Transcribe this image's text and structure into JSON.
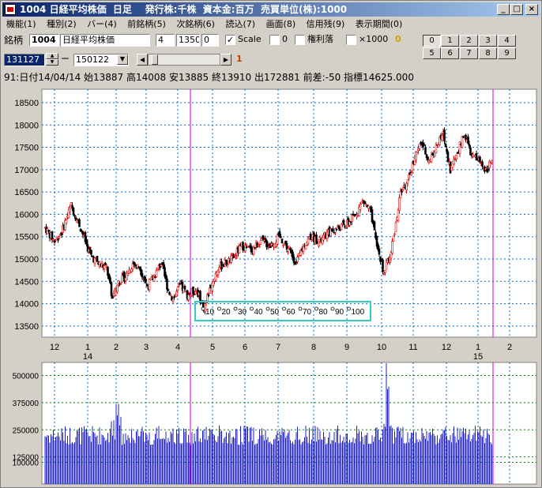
{
  "window": {
    "title": "1004 日経平均株価  日足    発行株:千株  資本金:百万  売買単位(株):1000",
    "min": "_",
    "max": "□",
    "close": "×"
  },
  "menu": [
    "機能(1)",
    "種別(2)",
    "バー(4)",
    "前銘柄(5)",
    "次銘柄(6)",
    "読込(7)",
    "画面(8)",
    "信用残(9)",
    "表示期間(0)"
  ],
  "toolbar": {
    "label_code": "銘柄",
    "code": "1004",
    "name": "日経平均株価",
    "f1": "4",
    "f2": "1350",
    "f3": "0",
    "scale_label": "Scale",
    "zero_label": "0",
    "kenri_label": "権利落",
    "x1000_label": "×1000",
    "badge0": "0",
    "date_from": "131127",
    "dash": "ー",
    "date_to": "150122",
    "badge1": "1",
    "left_arrow": "◀",
    "right_arrow": "▶",
    "num_buttons": [
      "0",
      "1",
      "2",
      "3",
      "4",
      "5",
      "6",
      "7",
      "8",
      "9"
    ],
    "selected_num": "0"
  },
  "info": "91:日付14/04/14 始13887 高14008 安13885 終13910 出172881 前差:-50 指標14625.000",
  "price_chart": {
    "ylim": [
      13250,
      18800
    ],
    "y_ticks": [
      13500,
      14000,
      14500,
      15000,
      15500,
      16000,
      16500,
      17000,
      17500,
      18000,
      18500
    ],
    "x_month_labels": [
      "12",
      "1",
      "2",
      "3",
      "4",
      "5",
      "6",
      "7",
      "8",
      "9",
      "10",
      "11",
      "12",
      "1",
      "2"
    ],
    "year_labels": [
      "14",
      "15"
    ],
    "overlay_labels": [
      "10",
      "20",
      "30",
      "40",
      "50",
      "60",
      "70",
      "80",
      "90",
      "100"
    ],
    "colors": {
      "up": "#e00000",
      "down": "#000000",
      "grid": "#0066cc",
      "cursor": "#cc00cc",
      "overlay": "#33cccc"
    }
  },
  "volume_chart": {
    "ylim": [
      0,
      560000
    ],
    "y_ticks": [
      100000,
      125000,
      250000,
      375000,
      500000
    ],
    "tick_labels": [
      "100000",
      "125000",
      "250000",
      "375000",
      "500000"
    ],
    "bar_color": "#2020c0"
  },
  "chart_data": [
    {
      "type": "candlestick",
      "series_close_anchors": [
        [
          0,
          15700
        ],
        [
          8,
          15400
        ],
        [
          14,
          15600
        ],
        [
          22,
          16200
        ],
        [
          30,
          15700
        ],
        [
          38,
          15100
        ],
        [
          45,
          14900
        ],
        [
          52,
          14800
        ],
        [
          57,
          14100
        ],
        [
          62,
          14500
        ],
        [
          68,
          14600
        ],
        [
          74,
          14900
        ],
        [
          80,
          14800
        ],
        [
          86,
          14400
        ],
        [
          92,
          14600
        ],
        [
          98,
          14900
        ],
        [
          104,
          14300
        ],
        [
          108,
          14100
        ],
        [
          114,
          14400
        ],
        [
          120,
          14200
        ],
        [
          128,
          14300
        ],
        [
          134,
          13900
        ],
        [
          140,
          14400
        ],
        [
          146,
          14800
        ],
        [
          152,
          14900
        ],
        [
          158,
          15000
        ],
        [
          166,
          15300
        ],
        [
          174,
          15200
        ],
        [
          182,
          15400
        ],
        [
          190,
          15300
        ],
        [
          198,
          15500
        ],
        [
          206,
          15200
        ],
        [
          212,
          14900
        ],
        [
          218,
          15300
        ],
        [
          224,
          15500
        ],
        [
          232,
          15400
        ],
        [
          240,
          15600
        ],
        [
          248,
          15700
        ],
        [
          256,
          15800
        ],
        [
          262,
          16000
        ],
        [
          268,
          16300
        ],
        [
          274,
          16100
        ],
        [
          280,
          15300
        ],
        [
          286,
          14700
        ],
        [
          292,
          15200
        ],
        [
          296,
          15800
        ],
        [
          300,
          16500
        ],
        [
          306,
          16700
        ],
        [
          312,
          17300
        ],
        [
          318,
          17600
        ],
        [
          324,
          17200
        ],
        [
          330,
          17500
        ],
        [
          336,
          17800
        ],
        [
          342,
          17000
        ],
        [
          348,
          17400
        ],
        [
          354,
          17800
        ],
        [
          360,
          17300
        ],
        [
          366,
          17200
        ],
        [
          372,
          17000
        ],
        [
          377,
          17200
        ]
      ]
    },
    {
      "type": "bar",
      "name": "volume"
    }
  ]
}
